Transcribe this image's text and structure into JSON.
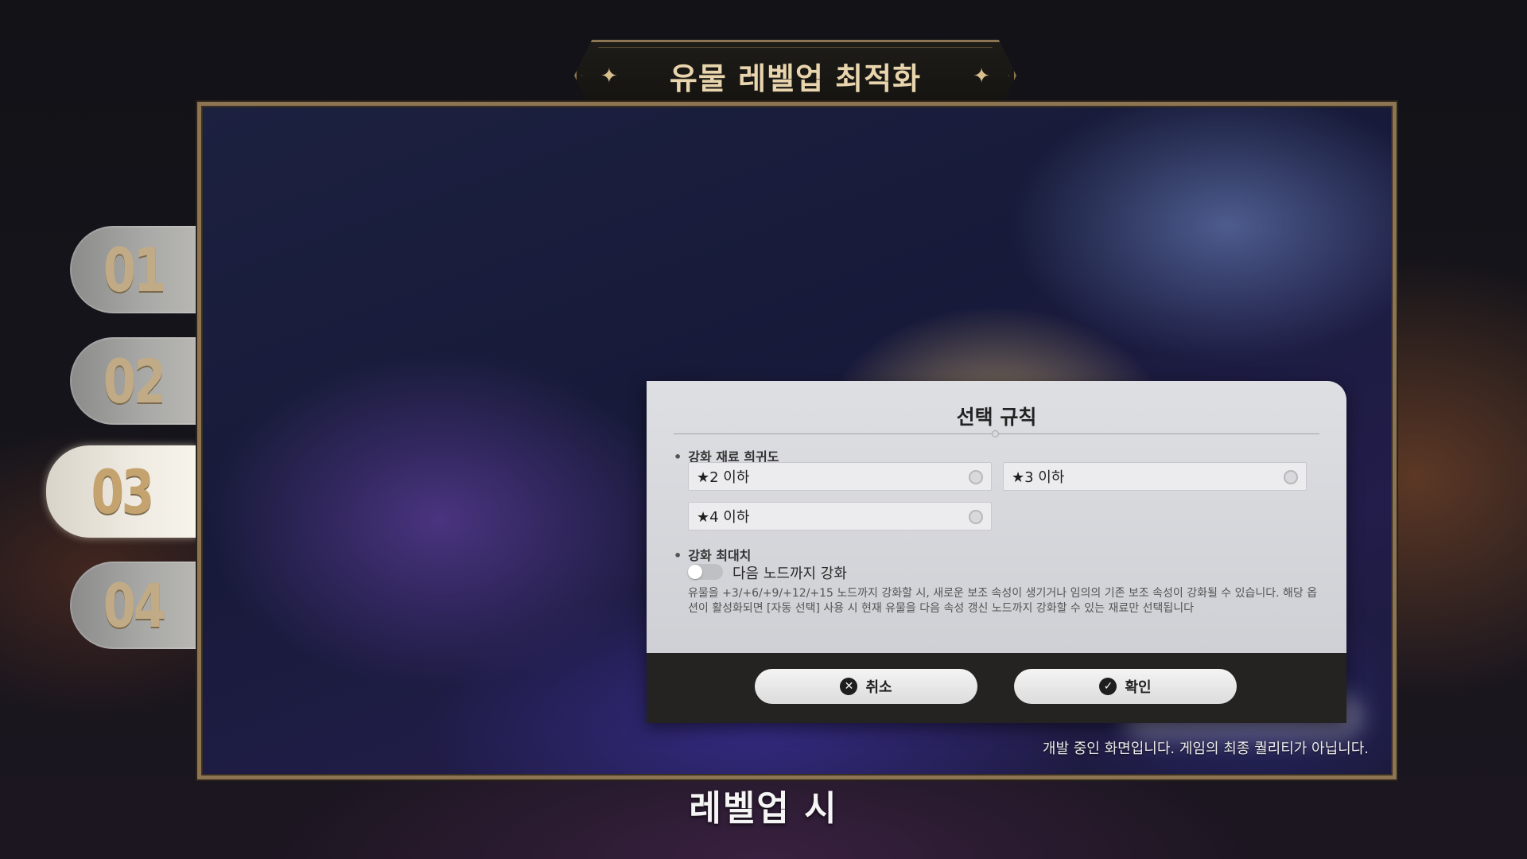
{
  "header": {
    "title": "유물 레벨업 최적화",
    "star_glyph": "✦"
  },
  "steps": [
    "01",
    "02",
    "03",
    "04"
  ],
  "active_step": "03",
  "dialog": {
    "title": "선택 규칙",
    "rarity_section": "강화 재료 희귀도",
    "rarity_options": [
      "★2 이하",
      "★3 이하",
      "★4 이하"
    ],
    "max_section": "강화 최대치",
    "toggle_label": "다음 노드까지 강화",
    "toggle_on": false,
    "description": "유물을 +3/+6/+9/+12/+15 노드까지 강화할 시, 새로운 보조 속성이 생기거나 임의의 기존 보조 속성이 강화될 수 있습니다. 해당 옵션이 활성화되면 [자동 선택] 사용 시 현재 유물을 다음 속성 갱신 노드까지 강화할 수 있는 재료만 선택됩니다",
    "cancel_label": "취소",
    "confirm_label": "확인"
  },
  "notice": "개발 중인 화면입니다. 게임의 최종 퀄리티가 아닙니다.",
  "subtitle": "레벨업 시",
  "colors": {
    "gold": "#8d7554",
    "title_text": "#e9d5ad",
    "footer": "#242322"
  }
}
